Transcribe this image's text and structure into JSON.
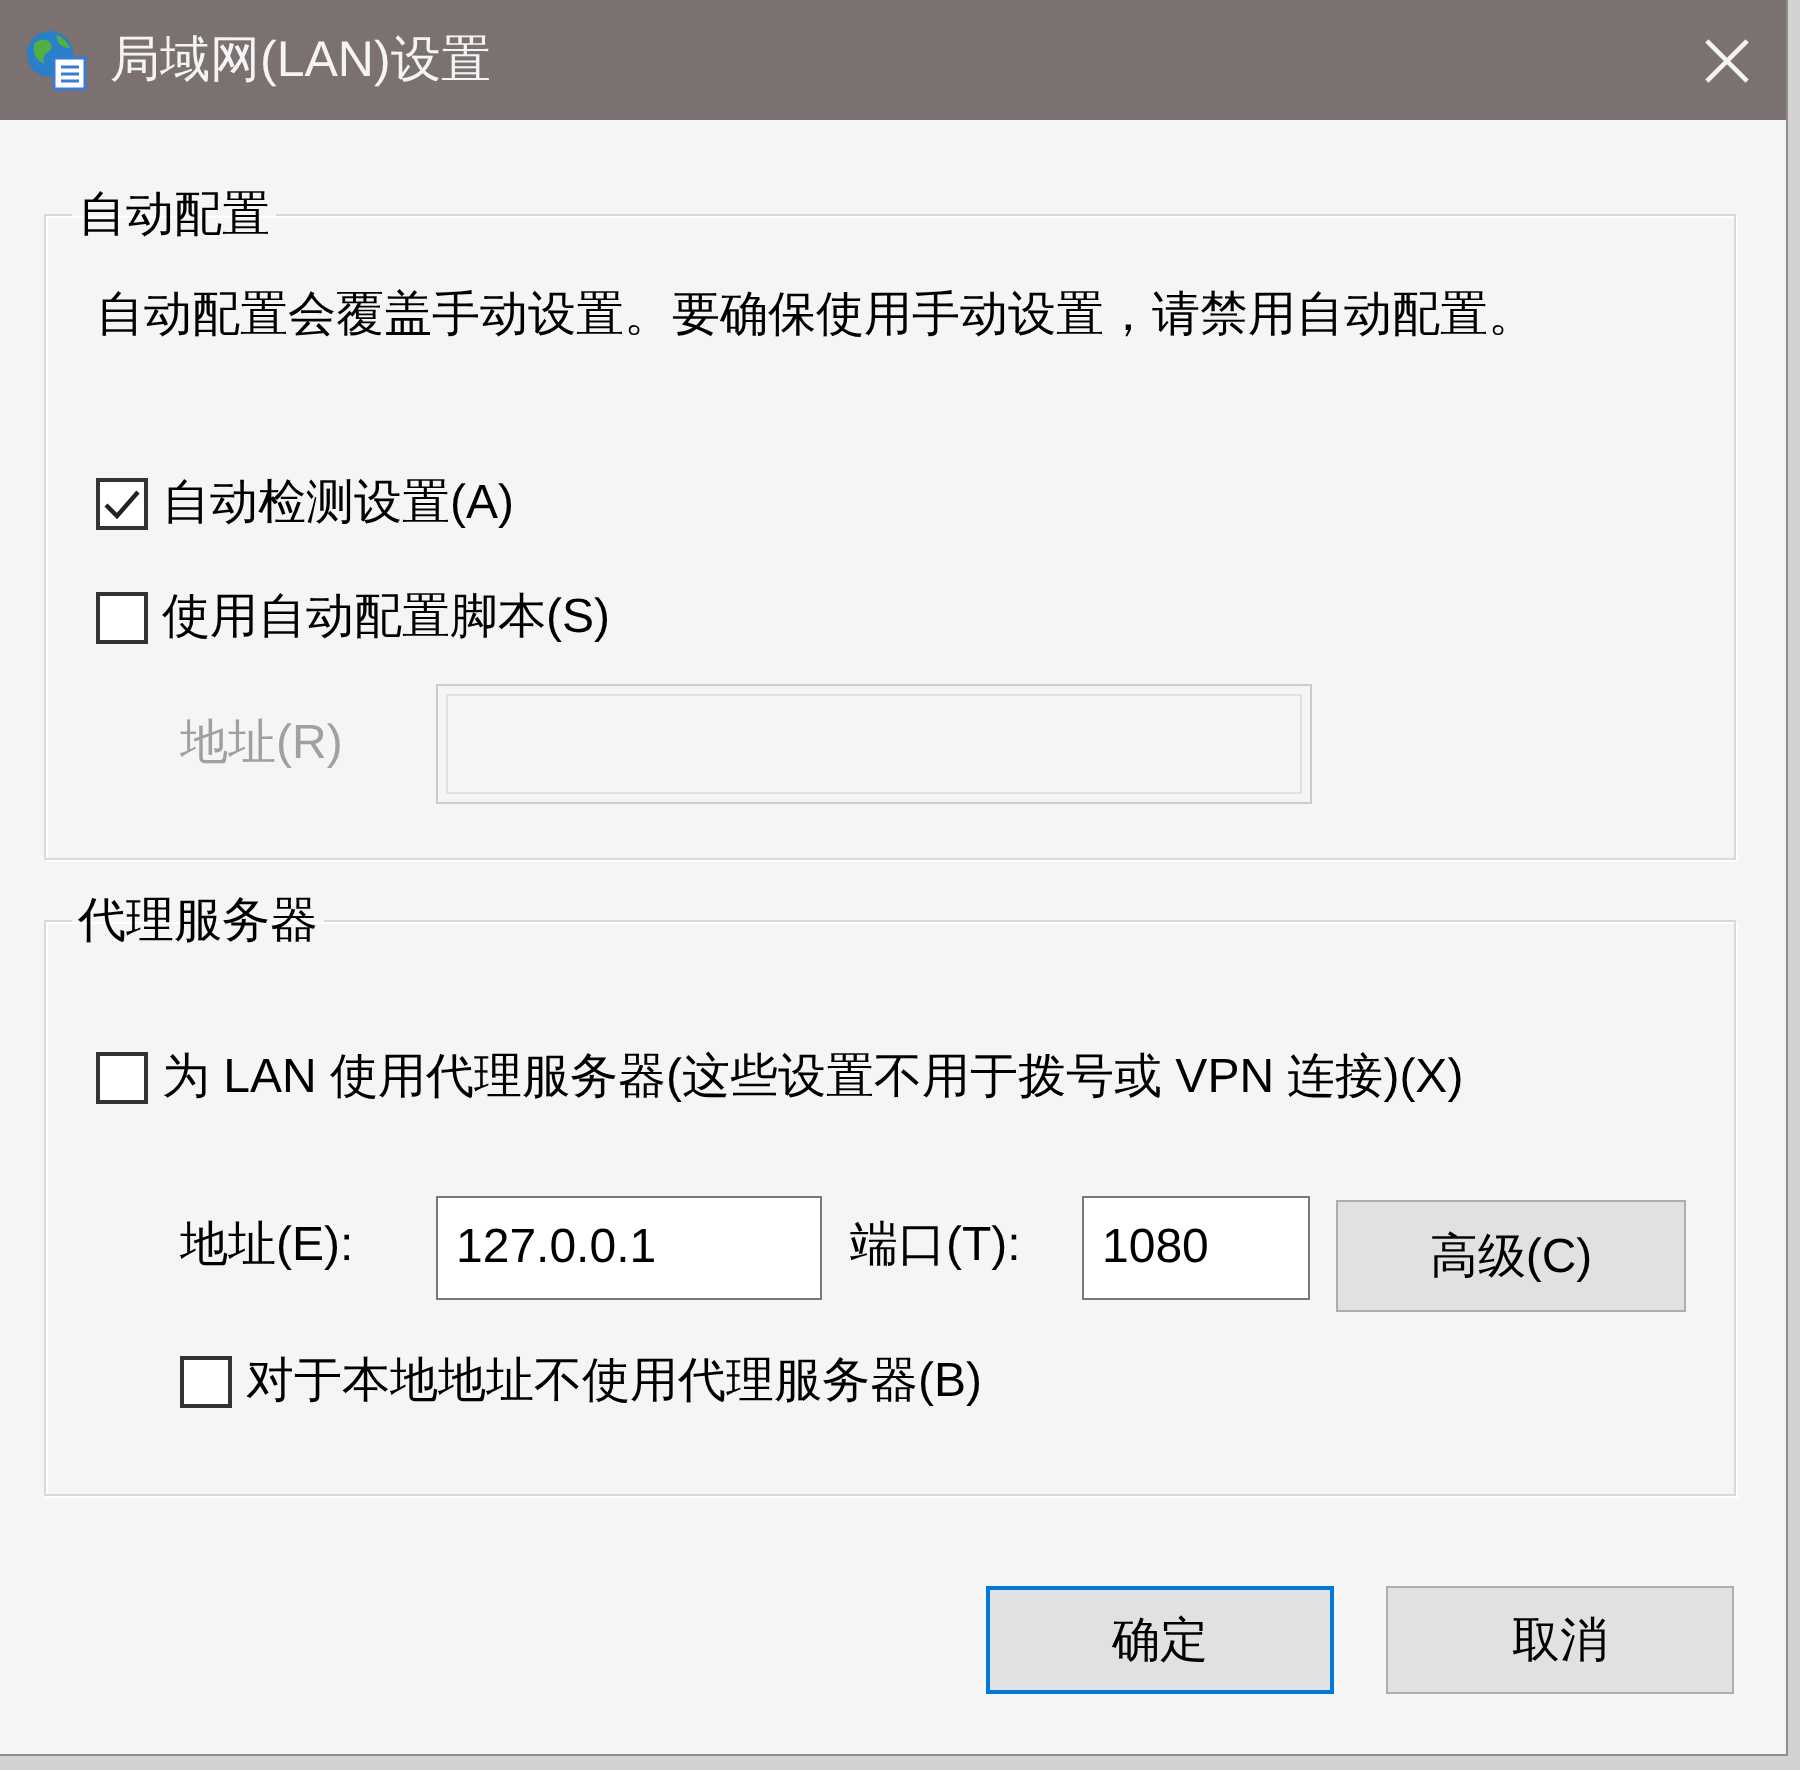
{
  "window": {
    "title": "局域网(LAN)设置"
  },
  "auto_config": {
    "legend": "自动配置",
    "description": "自动配置会覆盖手动设置。要确保使用手动设置，请禁用自动配置。",
    "options": [
      {
        "label": "自动检测设置(A)",
        "checked": true
      },
      {
        "label": "使用自动配置脚本(S)",
        "checked": false
      }
    ],
    "address": {
      "label": "地址(R)",
      "disabled": true
    }
  },
  "proxy": {
    "legend": "代理服务器",
    "use_proxy": {
      "label": "为 LAN 使用代理服务器(这些设置不用于拨号或 VPN 连接)(X)",
      "checked": false
    },
    "address": {
      "label": "地址(E):",
      "value": "127.0.0.1"
    },
    "port": {
      "label": "端口(T):",
      "value": "1080"
    },
    "advanced_button": "高级(C)",
    "bypass_local": {
      "label": "对于本地地址不使用代理服务器(B)",
      "checked": false
    }
  },
  "buttons": [
    {
      "label": "确定",
      "default": true
    },
    {
      "label": "取消",
      "default": false
    }
  ]
}
